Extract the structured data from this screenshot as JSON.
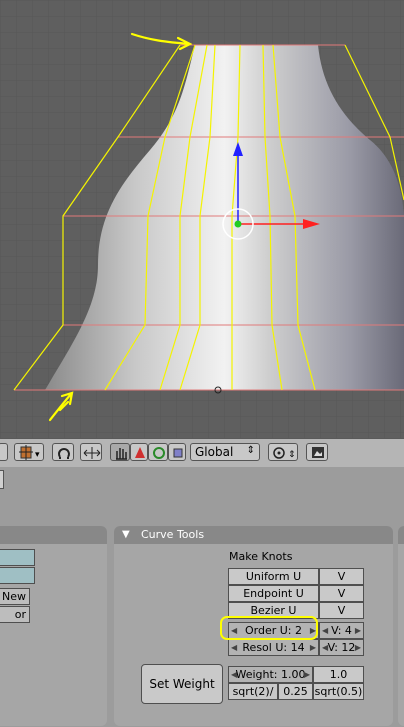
{
  "header": {
    "orientation_value": "Global"
  },
  "left_panel": {
    "buttons": [
      "New",
      "or"
    ]
  },
  "curve_tools": {
    "title": "Curve Tools",
    "make_knots_label": "Make Knots",
    "knot_rows": [
      {
        "label": "Uniform U",
        "v": "V"
      },
      {
        "label": "Endpoint U",
        "v": "V"
      },
      {
        "label": "Bezier U",
        "v": "V"
      }
    ],
    "order_u": "Order U: 2",
    "order_v": "V: 4",
    "resol_u": "Resol U: 14",
    "resol_v": "V: 12",
    "set_weight_label": "Set Weight",
    "weight_field": "Weight: 1.00",
    "weight_1": "1.0",
    "weight_sqrt2": "sqrt(2)/",
    "weight_025": "0.25",
    "weight_sqrt05": "sqrt(0.5)"
  },
  "colors": {
    "viewport_bg": "#5f5f5f",
    "curve_yellow": "#f4f400",
    "curve_pink": "#e07a7a",
    "axis_blue": "#2222ff",
    "axis_red": "#ff2020",
    "highlight_yellow": "#ffff00"
  }
}
